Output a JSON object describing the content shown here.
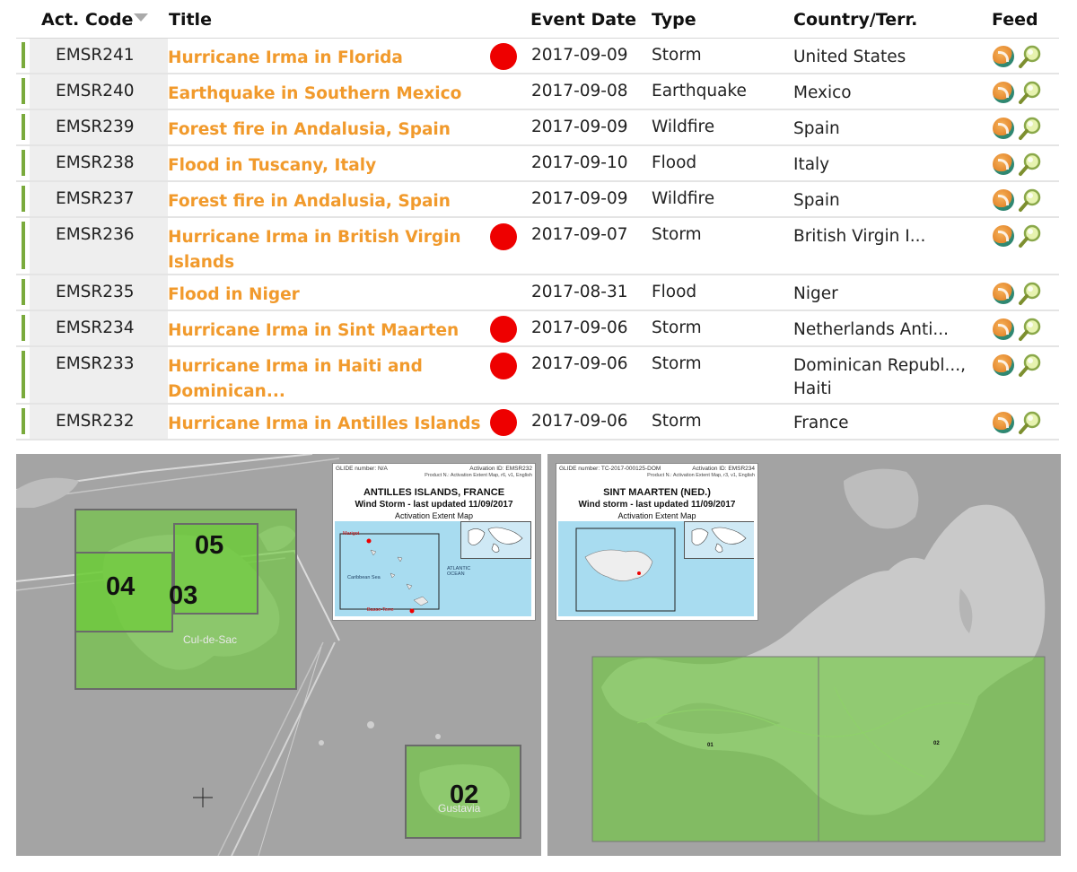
{
  "table": {
    "headers": {
      "code": "Act. Code",
      "title": "Title",
      "date": "Event Date",
      "type": "Type",
      "country": "Country/Terr.",
      "feed": "Feed"
    },
    "rows": [
      {
        "code": "EMSR241",
        "title": "Hurricane Irma in Florida",
        "date": "2017-09-09",
        "type": "Storm",
        "country": "United States",
        "flag": true
      },
      {
        "code": "EMSR240",
        "title": "Earthquake in Southern Mexico",
        "date": "2017-09-08",
        "type": "Earthquake",
        "country": "Mexico",
        "flag": false
      },
      {
        "code": "EMSR239",
        "title": "Forest fire in Andalusia, Spain",
        "date": "2017-09-09",
        "type": "Wildfire",
        "country": "Spain",
        "flag": false
      },
      {
        "code": "EMSR238",
        "title": "Flood in Tuscany, Italy",
        "date": "2017-09-10",
        "type": "Flood",
        "country": "Italy",
        "flag": false
      },
      {
        "code": "EMSR237",
        "title": "Forest fire in Andalusia, Spain",
        "date": "2017-09-09",
        "type": "Wildfire",
        "country": "Spain",
        "flag": false
      },
      {
        "code": "EMSR236",
        "title": "Hurricane Irma in British Virgin Islands",
        "date": "2017-09-07",
        "type": "Storm",
        "country": "British Virgin I...",
        "flag": true
      },
      {
        "code": "EMSR235",
        "title": "Flood in Niger",
        "date": "2017-08-31",
        "type": "Flood",
        "country": "Niger",
        "flag": false
      },
      {
        "code": "EMSR234",
        "title": "Hurricane Irma in Sint Maarten",
        "date": "2017-09-06",
        "type": "Storm",
        "country": "Netherlands Anti...",
        "flag": true
      },
      {
        "code": "EMSR233",
        "title": "Hurricane Irma in Haiti and Dominican...",
        "date": "2017-09-06",
        "type": "Storm",
        "country": "Dominican Republ..., Haiti",
        "flag": true
      },
      {
        "code": "EMSR232",
        "title": "Hurricane Irma in Antilles Islands",
        "date": "2017-09-06",
        "type": "Storm",
        "country": "France",
        "flag": true
      }
    ]
  },
  "map_left": {
    "zones": [
      "04",
      "03",
      "05",
      "02"
    ],
    "places": {
      "cul_de_sac": "Cul-de-Sac",
      "gustavia": "Gustavia",
      "marigot_area": "Marigot"
    },
    "inset": {
      "glide": "GLIDE number: N/A",
      "activation": "Activation ID: EMSR232",
      "product": "Product N.: Activation Extent Map, r6, v1, English",
      "title": "ANTILLES ISLANDS, FRANCE",
      "subtitle": "Wind Storm - last updated 11/09/2017",
      "map_type": "Activation Extent Map",
      "labels": {
        "marigot": "Marigot",
        "caribbean": "Caribbean Sea",
        "atlantic": "ATLANTIC OCEAN",
        "basse_terre": "Basse-Terre"
      }
    }
  },
  "map_right": {
    "zones": [
      "01",
      "02"
    ],
    "inset": {
      "glide": "GLIDE number: TC-2017-000125-DOM",
      "activation": "Activation ID: EMSR234",
      "product": "Product N.: Activation Extent Map, r3, v1, English",
      "title": "SINT MAARTEN (NED.)",
      "subtitle": "Wind storm - last updated 11/09/2017",
      "map_type": "Activation Extent Map"
    }
  },
  "colors": {
    "title_link": "#f19a2c",
    "status_bar": "#7aaa3c",
    "flag_dot": "#ee0000",
    "zone_fill": "#6ccc38"
  },
  "icons": {
    "rss": "rss-feed-icon",
    "map": "map-magnifier-icon",
    "sort": "sort-desc-icon",
    "crosshair": "crosshair-cursor-icon"
  }
}
